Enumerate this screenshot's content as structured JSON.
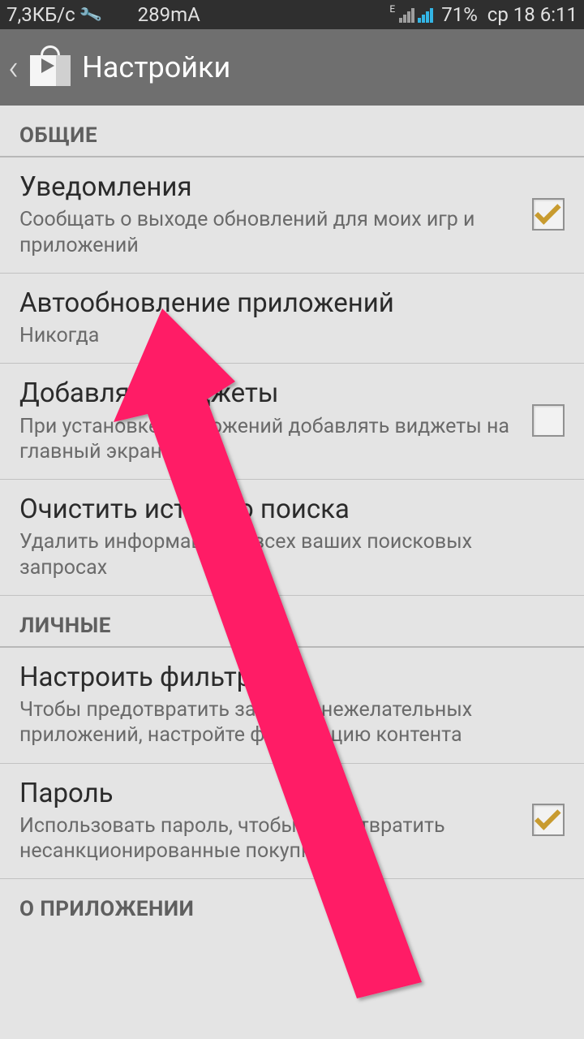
{
  "statusbar": {
    "speed": "7,3КБ/с",
    "current": "289mA",
    "battery": "71%",
    "date": "ср 18 6:11"
  },
  "header": {
    "title": "Настройки"
  },
  "sections": {
    "general": "ОБЩИЕ",
    "personal": "ЛИЧНЫЕ",
    "about": "О ПРИЛОЖЕНИИ"
  },
  "items": {
    "notifications": {
      "title": "Уведомления",
      "sub": "Сообщать о выходе обновлений для моих игр и приложений"
    },
    "autoupdate": {
      "title": "Автообновление приложений",
      "sub": "Никогда"
    },
    "widgets": {
      "title": "Добавлять виджеты",
      "sub": "При установке приложений добавлять виджеты на главный экран"
    },
    "clearsearch": {
      "title": "Очистить историю поиска",
      "sub": "Удалить информацию о всех ваших поисковых запросах"
    },
    "filter": {
      "title": "Настроить фильтр",
      "sub": "Чтобы предотвратить загрузку нежелательных приложений, настройте фильтрацию контента"
    },
    "password": {
      "title": "Пароль",
      "sub": "Использовать пароль, чтобы предотвратить несанкционированные покупки"
    }
  }
}
